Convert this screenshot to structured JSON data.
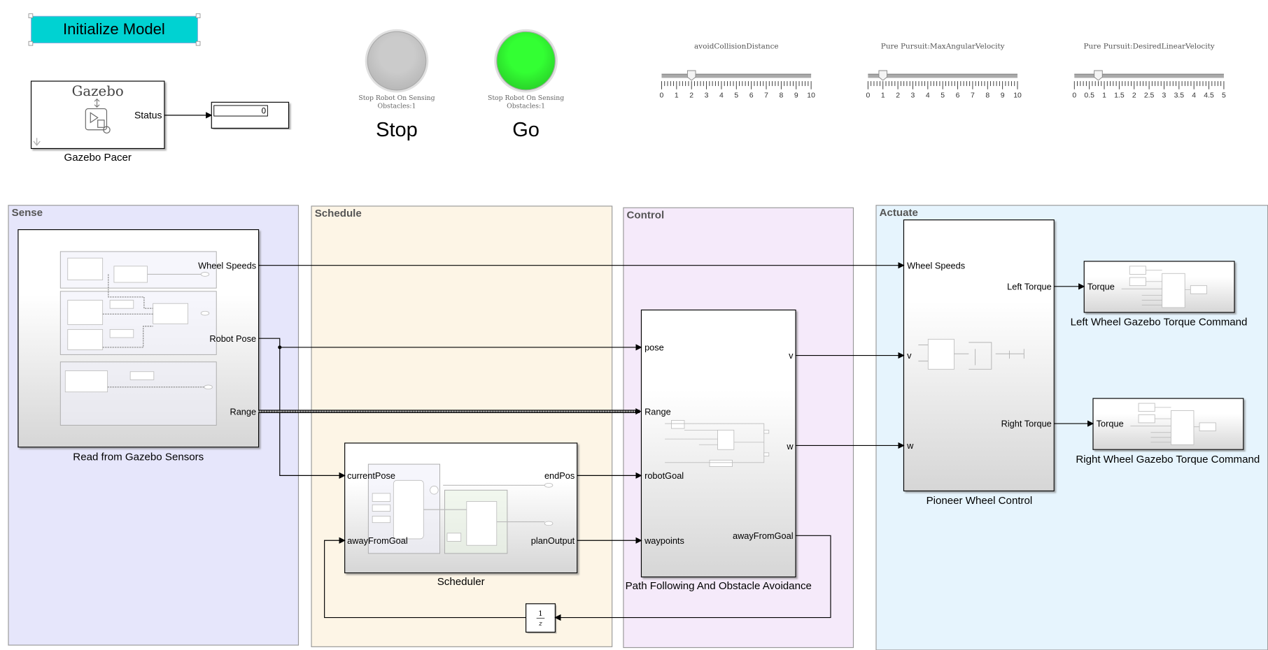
{
  "init_button": {
    "label": "Initialize Model",
    "color": "#00d2d2"
  },
  "gazebo_pacer": {
    "icon_text": "Gazebo",
    "port": "Status",
    "label": "Gazebo Pacer"
  },
  "display": {
    "value": "0"
  },
  "lamps": [
    {
      "caption_line1": "Stop Robot On Sensing",
      "caption_line2": "Obstacles:1",
      "label": "Stop",
      "color": "#c8c8c8"
    },
    {
      "caption_line1": "Stop Robot On Sensing",
      "caption_line2": "Obstacles:1",
      "label": "Go",
      "color": "#33ff33"
    }
  ],
  "sliders": [
    {
      "title": "avoidCollisionDistance",
      "min": 0,
      "max": 10,
      "value": 2,
      "ticks": [
        "0",
        "1",
        "2",
        "3",
        "4",
        "5",
        "6",
        "7",
        "8",
        "9",
        "10"
      ]
    },
    {
      "title": "Pure Pursuit:MaxAngularVelocity",
      "min": 0,
      "max": 10,
      "value": 1,
      "ticks": [
        "0",
        "1",
        "2",
        "3",
        "4",
        "5",
        "6",
        "7",
        "8",
        "9",
        "10"
      ]
    },
    {
      "title": "Pure Pursuit:DesiredLinearVelocity",
      "min": 0,
      "max": 5,
      "value": 0.8,
      "ticks": [
        "0",
        "0.5",
        "1",
        "1.5",
        "2",
        "2.5",
        "3",
        "3.5",
        "4",
        "4.5",
        "5"
      ]
    }
  ],
  "areas": [
    {
      "title": "Sense",
      "color": "#e6e6fb"
    },
    {
      "title": "Schedule",
      "color": "#fdf5e6"
    },
    {
      "title": "Control",
      "color": "#f5eafa"
    },
    {
      "title": "Actuate",
      "color": "#e6f4fd"
    }
  ],
  "blocks": {
    "sensors": {
      "label": "Read from Gazebo Sensors",
      "outputs": [
        "Wheel Speeds",
        "Robot Pose",
        "Range"
      ]
    },
    "scheduler": {
      "label": "Scheduler",
      "inputs": [
        "currentPose",
        "awayFromGoal"
      ],
      "outputs": [
        "endPos",
        "planOutput"
      ]
    },
    "path": {
      "label": "Path Following And Obstacle Avoidance",
      "inputs": [
        "pose",
        "Range",
        "robotGoal",
        "waypoints"
      ],
      "outputs": [
        "v",
        "w",
        "awayFromGoal"
      ]
    },
    "wheel": {
      "label": "Pioneer Wheel Control",
      "inputs": [
        "Wheel Speeds",
        "v",
        "w"
      ],
      "outputs": [
        "Left Torque",
        "Right Torque"
      ]
    },
    "left": {
      "label": "Left Wheel Gazebo Torque Command",
      "input": "Torque"
    },
    "right": {
      "label": "Right Wheel Gazebo Torque Command",
      "input": "Torque"
    },
    "delay": {
      "num": "1",
      "den": "z"
    }
  }
}
